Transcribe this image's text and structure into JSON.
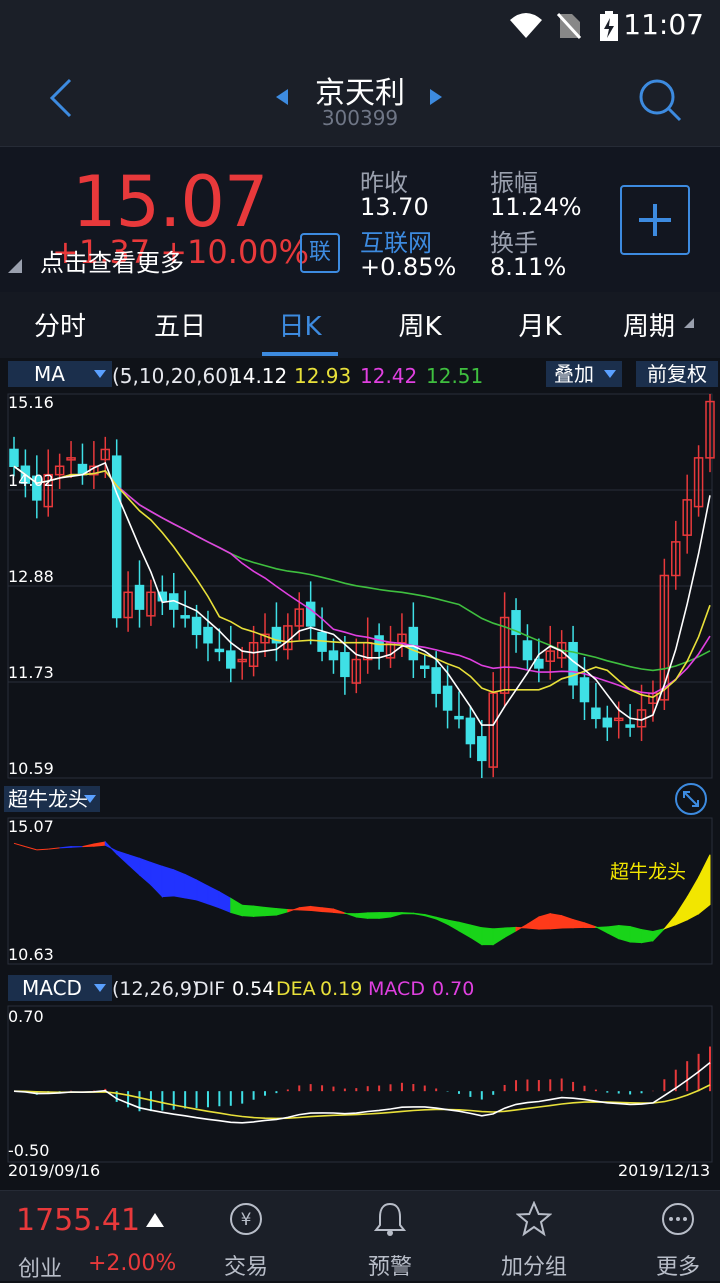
{
  "status": {
    "time": "11:07"
  },
  "header": {
    "title": "京天利",
    "code": "300399"
  },
  "quote": {
    "price": "15.07",
    "change": "+1.37 +10.00%",
    "tip": "点击查看更多",
    "badge": "联",
    "prev_close_label": "昨收",
    "prev_close": "13.70",
    "amplitude_label": "振幅",
    "amplitude": "11.24%",
    "sector_label": "互联网",
    "sector_change": "+0.85%",
    "turnover_label": "换手",
    "turnover": "8.11%"
  },
  "tabs": [
    "分时",
    "五日",
    "日K",
    "周K",
    "月K",
    "周期"
  ],
  "active_tab": "日K",
  "ma": {
    "select": "MA",
    "params": "(5,10,20,60)",
    "values": [
      "14.12",
      "12.93",
      "12.42",
      "12.51"
    ],
    "overlay": "叠加",
    "adjust": "前复权"
  },
  "kline": {
    "y_labels": [
      "15.16",
      "14.02",
      "12.88",
      "11.73",
      "10.59"
    ]
  },
  "indicator2": {
    "select": "超牛龙头",
    "top": "15.07",
    "bottom": "10.63",
    "signal_label": "超牛龙头"
  },
  "macd": {
    "select": "MACD",
    "params": "(12,26,9)",
    "dif_label": "DIF",
    "dif": "0.54",
    "dea_label": "DEA",
    "dea": "0.19",
    "macd_label": "MACD",
    "macd": "0.70",
    "top": "0.70",
    "bottom": "-0.50",
    "date_start": "2019/09/16",
    "date_end": "2019/12/13"
  },
  "bottom_nav": {
    "index_value": "1755.41",
    "index_name": "创业",
    "index_change": "+2.00%",
    "items": [
      "交易",
      "预警",
      "加分组",
      "更多"
    ]
  },
  "chart_data": {
    "type": "candlestick",
    "xlim": [
      "2019/09/16",
      "2019/12/13"
    ],
    "ylim": [
      10.59,
      15.16
    ],
    "closes": [
      14.3,
      14.1,
      13.9,
      14.2,
      14.3,
      14.4,
      14.2,
      14.3,
      14.5,
      12.5,
      12.8,
      12.6,
      12.8,
      12.7,
      12.6,
      12.5,
      12.3,
      12.2,
      12.1,
      11.9,
      12.0,
      12.2,
      12.3,
      12.2,
      12.4,
      12.6,
      12.4,
      12.1,
      12.0,
      11.8,
      12.0,
      12.2,
      12.1,
      12.2,
      12.3,
      12.0,
      11.9,
      11.6,
      11.4,
      11.3,
      11.0,
      10.8,
      11.6,
      12.5,
      12.3,
      12.0,
      11.9,
      12.1,
      12.2,
      11.7,
      11.5,
      11.3,
      11.2,
      11.3,
      11.2,
      11.4,
      11.6,
      13.0,
      13.4,
      13.9,
      14.4,
      15.07
    ]
  }
}
